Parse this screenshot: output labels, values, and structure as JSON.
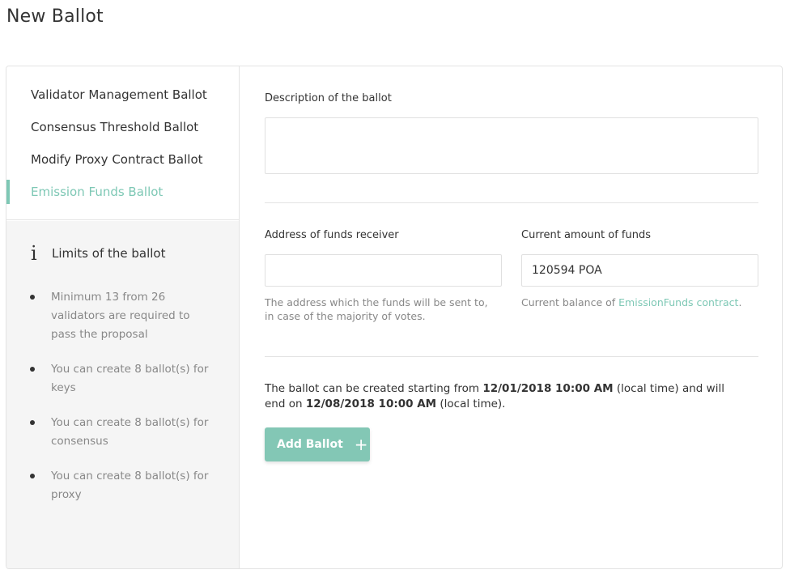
{
  "page": {
    "title": "New Ballot"
  },
  "sidebar": {
    "items": [
      {
        "label": "Validator Management Ballot",
        "active": false
      },
      {
        "label": "Consensus Threshold Ballot",
        "active": false
      },
      {
        "label": "Modify Proxy Contract Ballot",
        "active": false
      },
      {
        "label": "Emission Funds Ballot",
        "active": true
      }
    ],
    "limits": {
      "icon": "info-icon",
      "icon_glyph": "i",
      "title": "Limits of the ballot",
      "items": [
        "Minimum 13 from 26 validators are required to pass the proposal",
        "You can create 8 ballot(s) for keys",
        "You can create 8 ballot(s) for consensus",
        "You can create 8 ballot(s) for proxy"
      ]
    }
  },
  "form": {
    "description": {
      "label": "Description of the ballot",
      "value": ""
    },
    "receiver": {
      "label": "Address of funds receiver",
      "value": "",
      "help": "The address which the funds will be sent to, in case of the majority of votes."
    },
    "funds": {
      "label": "Current amount of funds",
      "value": "120594 POA",
      "help_prefix": "Current balance of ",
      "help_link": "EmissionFunds contract",
      "help_suffix": "."
    },
    "schedule": {
      "prefix": "The ballot can be created starting from ",
      "start": "12/01/2018 10:00 AM",
      "middle": " (local time) and will end on ",
      "end": "12/08/2018 10:00 AM",
      "suffix": " (local time)."
    },
    "add_button": {
      "label": "Add Ballot",
      "icon": "plus-icon",
      "icon_glyph": "+"
    }
  },
  "colors": {
    "accent": "#7ec8b5",
    "button": "#83c7b5"
  }
}
